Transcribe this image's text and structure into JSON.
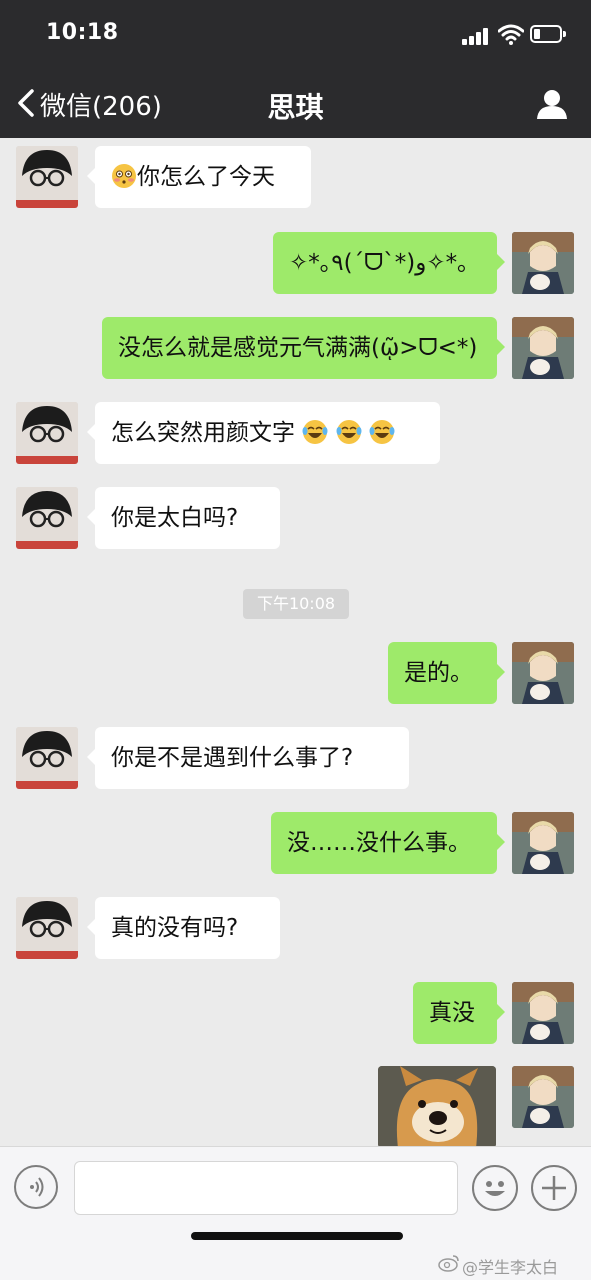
{
  "status_bar": {
    "time": "10:18"
  },
  "nav": {
    "back_label": "微信(206)",
    "title": "思琪"
  },
  "messages": [
    {
      "side": "left",
      "text": "你怎么了今天"
    },
    {
      "side": "right",
      "text": "✧*｡٩(ˊᗜˋ*)و✧*｡"
    },
    {
      "side": "right",
      "text": "没怎么就是感觉元气满满(ῷ>ᗜ<*)"
    },
    {
      "side": "left",
      "text": "怎么突然用颜文字"
    },
    {
      "side": "left",
      "text": "你是太白吗?"
    },
    {
      "side": "right",
      "text": "是的。"
    },
    {
      "side": "left",
      "text": "你是不是遇到什么事了?"
    },
    {
      "side": "right",
      "text": "没……没什么事。"
    },
    {
      "side": "left",
      "text": "真的没有吗?"
    },
    {
      "side": "right",
      "text": "真没"
    }
  ],
  "timestamp": "下午10:08",
  "input": {
    "placeholder": ""
  },
  "watermark": "@学生李太白",
  "colors": {
    "header": "#2b2b2d",
    "bubble_right": "#9eea6a",
    "bubble_left": "#ffffff",
    "background": "#ebebeb"
  }
}
